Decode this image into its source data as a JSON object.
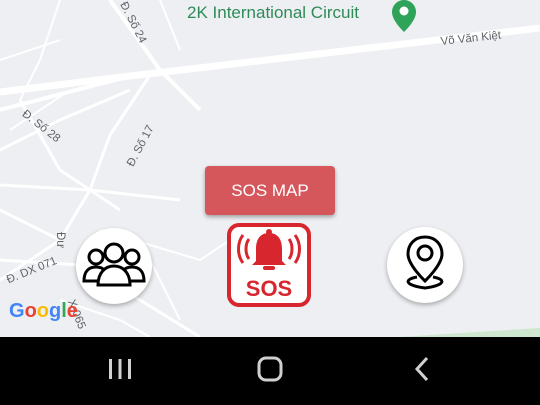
{
  "map": {
    "poi": {
      "name": "2K International Circuit",
      "icon": "location-pin-icon",
      "color": "#2e8b57"
    },
    "roads": [
      {
        "label": "Đ. Số 24"
      },
      {
        "label": "Võ Văn Kiệt"
      },
      {
        "label": "Đ. Số 28"
      },
      {
        "label": "Đ. Số 17"
      },
      {
        "label": "Đ. DX 071"
      },
      {
        "label": "Đư"
      },
      {
        "label": "X-065"
      }
    ],
    "attribution": {
      "letters": [
        "G",
        "o",
        "o",
        "g",
        "l",
        "e"
      ]
    }
  },
  "actions": {
    "sos_map_label": "SOS MAP",
    "sos_label": "SOS",
    "sos_color": "#d8262f",
    "sos_map_color": "#d5575c",
    "group_icon": "group-people-icon",
    "location_icon": "location-pin-icon"
  },
  "navbar": {
    "recent_icon": "recent-apps-icon",
    "home_icon": "home-icon",
    "back_icon": "back-icon"
  }
}
